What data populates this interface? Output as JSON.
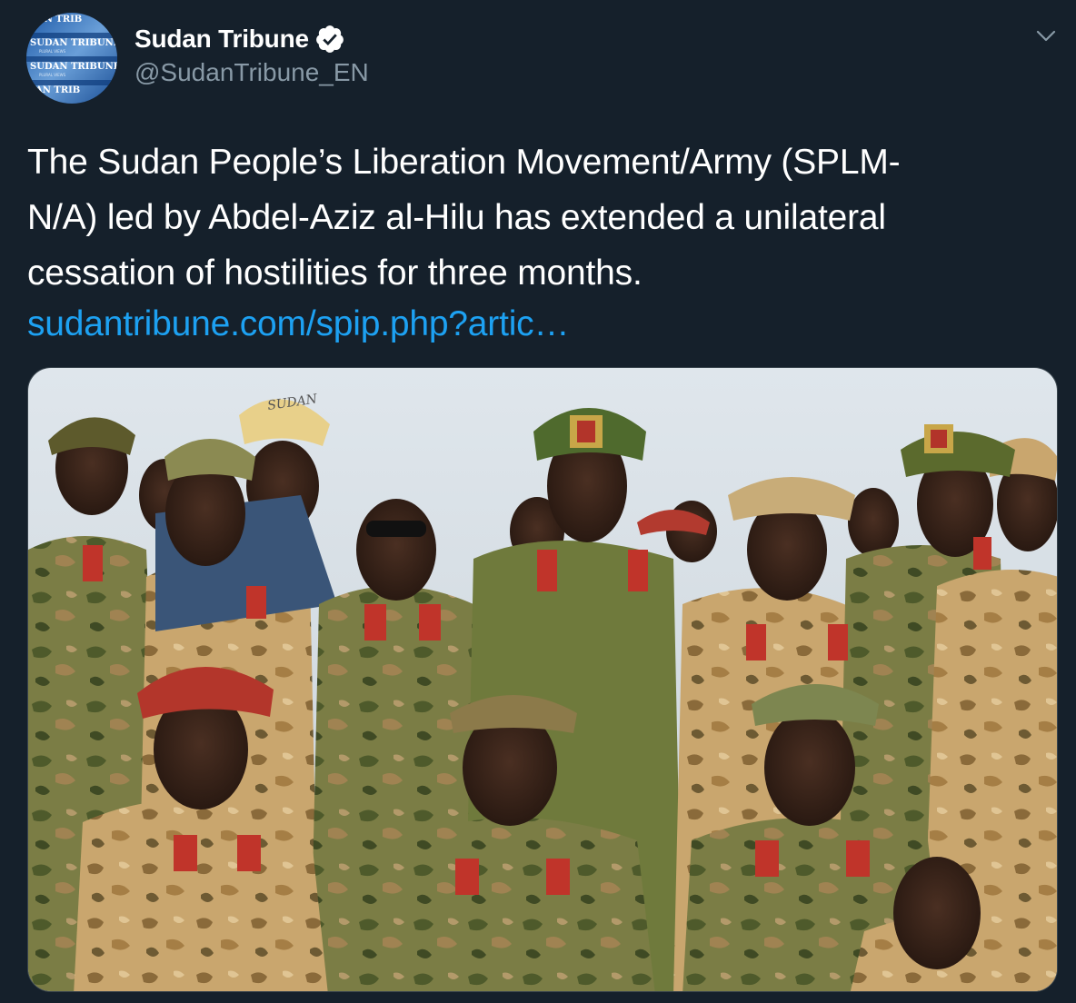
{
  "tweet": {
    "author": {
      "display_name": "Sudan Tribune",
      "handle": "@SudanTribune_EN",
      "verified": true,
      "avatar_text": [
        "SUDAN TRIBUNE",
        "SUDAN TRIBUNE",
        "SUDAN TRIBUNE",
        "SUDAN TRIBUNE"
      ]
    },
    "menu_icon": "chevron-down-icon",
    "text_lines": [
      "The Sudan People’s Liberation Movement/Army (SPLM-",
      "N/A) led by Abdel-Aziz al-Hilu has extended a unilateral",
      "cessation of hostilities for three months."
    ],
    "link": "sudantribune.com/spip.php?artic…",
    "media": {
      "type": "photo",
      "cap_text": "SUDAN"
    }
  },
  "colors": {
    "background": "#15202b",
    "text": "#ffffff",
    "secondary": "#8899a6",
    "link": "#1da1f2",
    "verified": "#ffffff"
  }
}
